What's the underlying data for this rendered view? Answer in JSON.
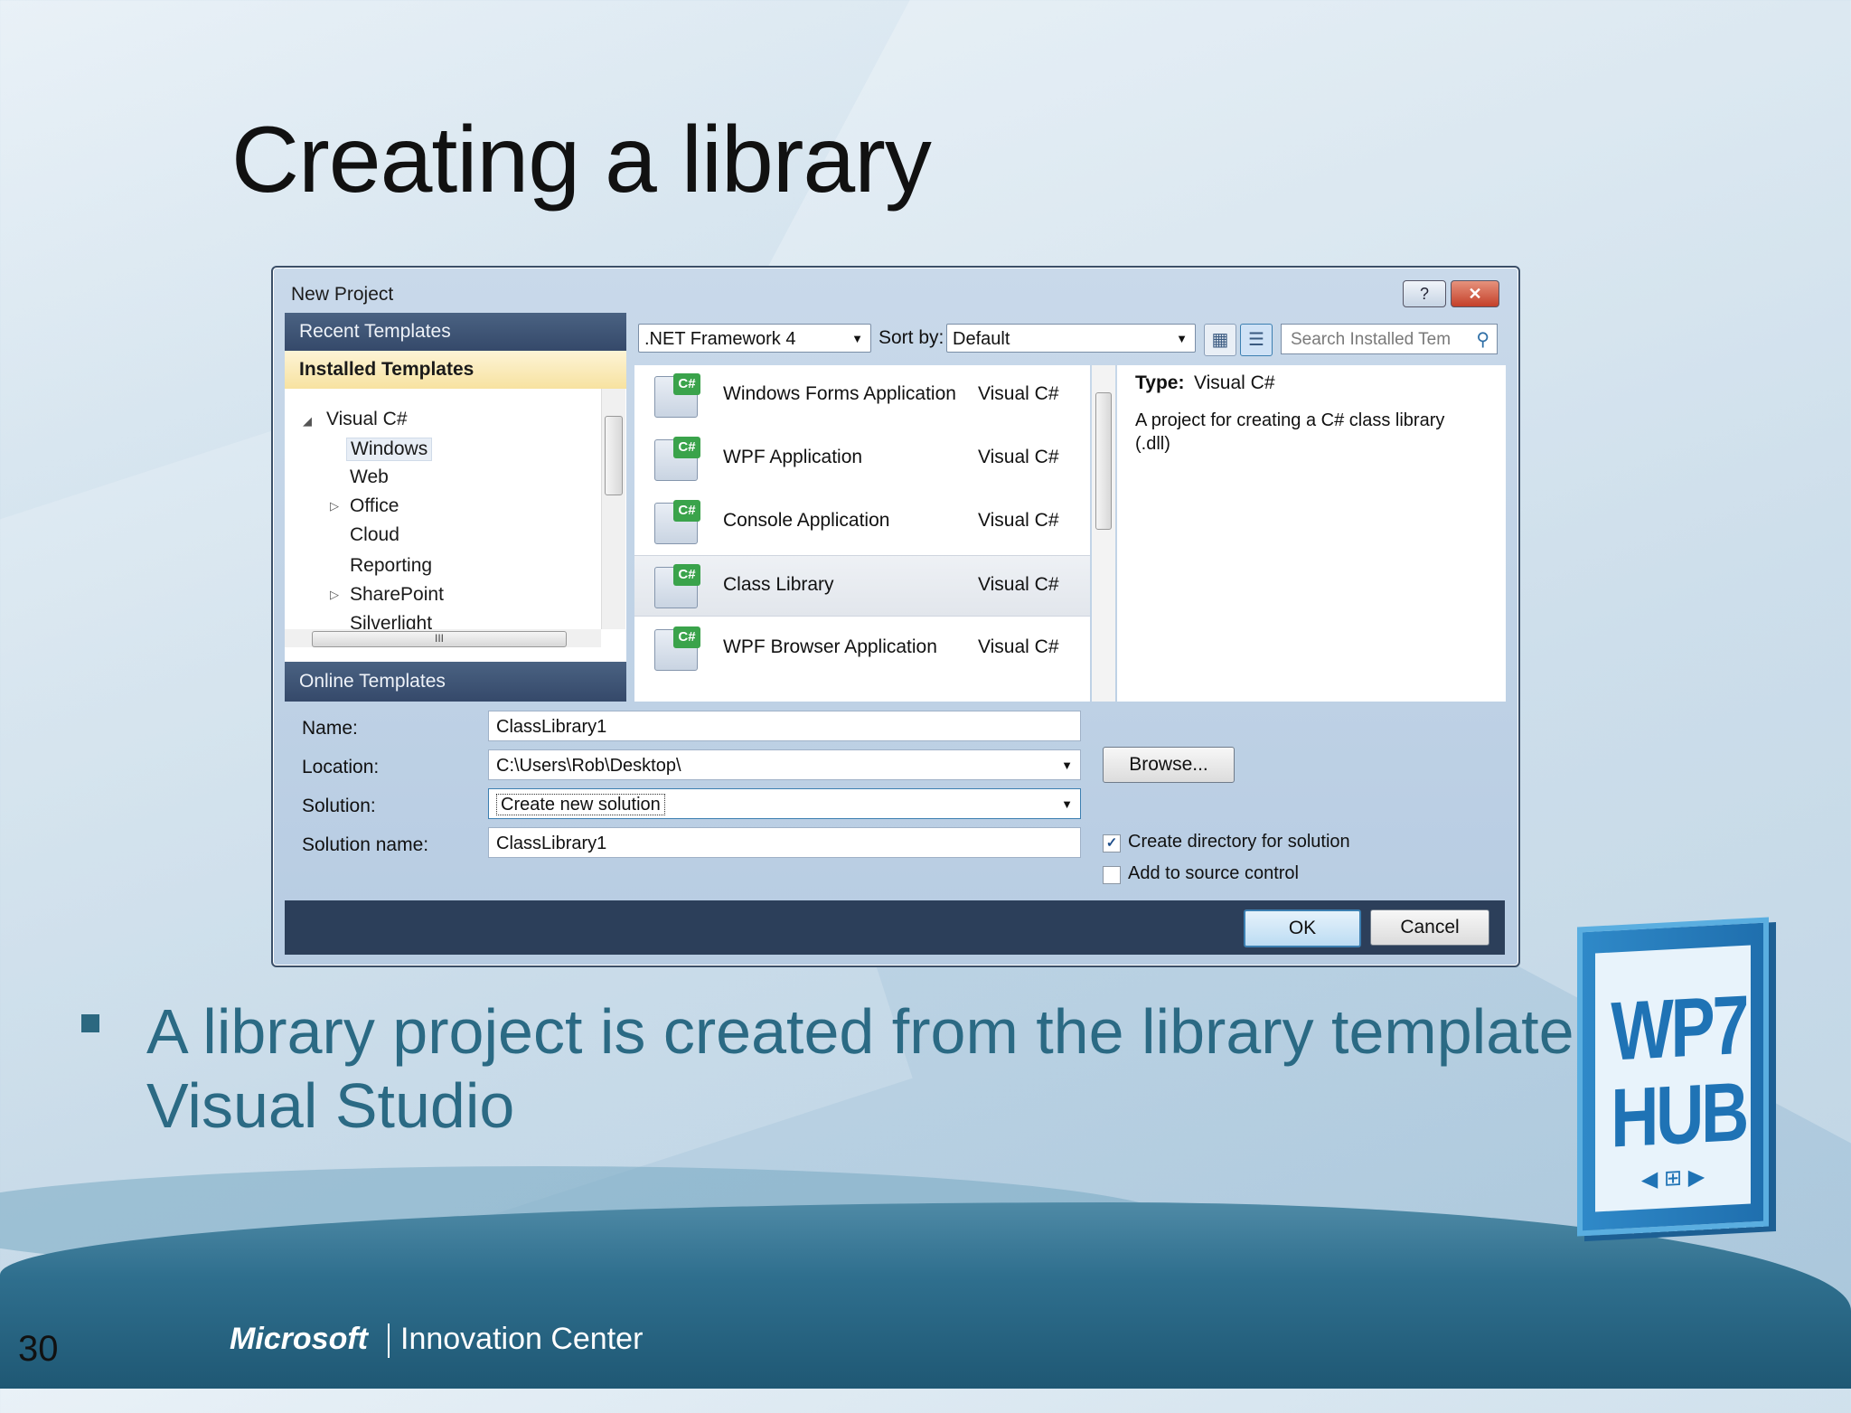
{
  "slide": {
    "title": "Creating a library",
    "bullet": "A library project is created from the library template in Visual Studio",
    "page_number": "30",
    "footer_brand": "Microsoft",
    "footer_suffix": "Innovation Center",
    "badge_line1": "WP7",
    "badge_line2": "HUB"
  },
  "dialog": {
    "title": "New Project",
    "help_label": "?",
    "close_label": "✕",
    "left_pane": {
      "recent_header": "Recent Templates",
      "installed_header": "Installed Templates",
      "online_header": "Online Templates",
      "tree": [
        {
          "label": "Visual C#",
          "expanded": true
        },
        {
          "label": "Windows",
          "selected": true
        },
        {
          "label": "Web"
        },
        {
          "label": "Office",
          "collapsed": true
        },
        {
          "label": "Cloud"
        },
        {
          "label": "Reporting"
        },
        {
          "label": "SharePoint",
          "collapsed": true
        },
        {
          "label": "Silverlight"
        }
      ]
    },
    "toolbar": {
      "framework": ".NET Framework 4",
      "sort_label": "Sort by:",
      "sort_value": "Default",
      "search_placeholder": "Search Installed Tem"
    },
    "templates": [
      {
        "name": "Windows Forms Application",
        "lang": "Visual C#"
      },
      {
        "name": "WPF Application",
        "lang": "Visual C#"
      },
      {
        "name": "Console Application",
        "lang": "Visual C#"
      },
      {
        "name": "Class Library",
        "lang": "Visual C#",
        "selected": true
      },
      {
        "name": "WPF Browser Application",
        "lang": "Visual C#"
      }
    ],
    "description": {
      "type_label": "Type:",
      "type_value": "Visual C#",
      "text": "A project for creating a C# class library (.dll)"
    },
    "form": {
      "name_label": "Name:",
      "name_value": "ClassLibrary1",
      "location_label": "Location:",
      "location_value": "C:\\Users\\Rob\\Desktop\\",
      "solution_label": "Solution:",
      "solution_value": "Create new solution",
      "solution_name_label": "Solution name:",
      "solution_name_value": "ClassLibrary1",
      "browse_label": "Browse...",
      "create_dir_label": "Create directory for solution",
      "create_dir_checked": true,
      "source_control_label": "Add to source control",
      "source_control_checked": false,
      "ok_label": "OK",
      "cancel_label": "Cancel"
    }
  }
}
